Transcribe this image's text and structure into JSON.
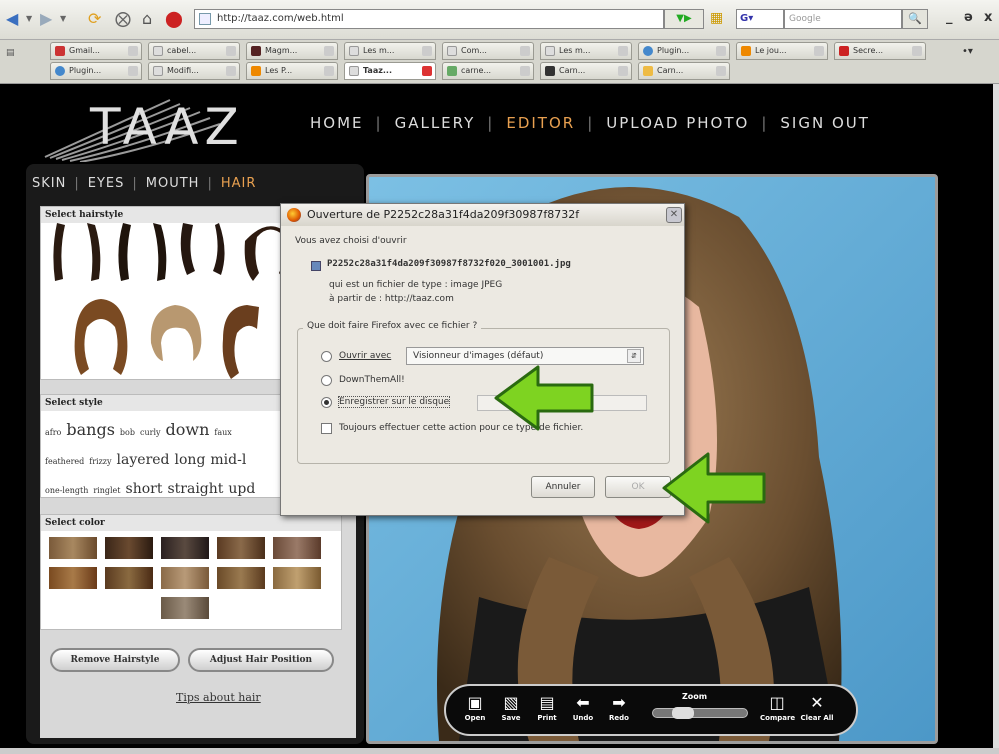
{
  "browser": {
    "url": "http://taaz.com/web.html",
    "search_engine": "G",
    "search_placeholder": "Google",
    "win_controls": [
      "_",
      "ə",
      "x"
    ]
  },
  "tabs_row1": [
    "Gmail...",
    "cabel...",
    "Magm...",
    "Les m...",
    "Com...",
    "Les m...",
    "Plugin...",
    "Le jou...",
    "Secre..."
  ],
  "tabs_row2": [
    "Plugin...",
    "Modifi...",
    "Les P...",
    "Taaz...",
    "carne...",
    "Carn...",
    "Carn..."
  ],
  "colors": {
    "accent_nav": "#e8a050",
    "photo_bg": "#5fa9d6",
    "arrow_green": "#7ed321"
  },
  "site": {
    "logo": "TAAZ",
    "nav": [
      "HOME",
      "GALLERY",
      "EDITOR",
      "UPLOAD PHOTO",
      "SIGN OUT"
    ],
    "active_nav": "EDITOR",
    "subtabs": [
      "SKIN",
      "EYES",
      "MOUTH",
      "HAIR"
    ],
    "active_subtab": "HAIR"
  },
  "hair_panel": {
    "select_hairstyle": "Select hairstyle",
    "select_style": "Select style",
    "style_tags": [
      [
        {
          "t": "afro",
          "s": "s"
        },
        {
          "t": "bangs",
          "s": "l"
        },
        {
          "t": "bob",
          "s": "s"
        },
        {
          "t": "curly",
          "s": "s"
        },
        {
          "t": "down",
          "s": "l"
        },
        {
          "t": "faux",
          "s": "s"
        }
      ],
      [
        {
          "t": "feathered",
          "s": "s"
        },
        {
          "t": "frizzy",
          "s": "s"
        },
        {
          "t": "layered",
          "s": "m"
        },
        {
          "t": "long",
          "s": "m"
        },
        {
          "t": "mid-l",
          "s": "m"
        }
      ],
      [
        {
          "t": "one-length",
          "s": "s"
        },
        {
          "t": "ringlet",
          "s": "s"
        },
        {
          "t": "short",
          "s": "m"
        },
        {
          "t": "straight",
          "s": "m"
        },
        {
          "t": "upd",
          "s": "m"
        }
      ]
    ],
    "select_color": "Select color",
    "remove_btn": "Remove Hairstyle",
    "adjust_btn": "Adjust Hair Position",
    "tips_link": "Tips about hair"
  },
  "editor_toolbar": {
    "open": "Open",
    "save": "Save",
    "print": "Print",
    "undo": "Undo",
    "redo": "Redo",
    "zoom": "Zoom",
    "zoom_level": 0.25,
    "compare": "Compare",
    "clear_all": "Clear All"
  },
  "dialog": {
    "title": "Ouverture de P2252c28a31f4da209f30987f8732f",
    "chose_open": "Vous avez choisi d'ouvrir",
    "filename": "P2252c28a31f4da209f30987f8732f020_3001001.jpg",
    "file_type": "qui est un fichier de type : image JPEG",
    "from": "à partir de : http://taaz.com",
    "question": "Que doit faire Firefox avec ce fichier ?",
    "open_with_label": "Ouvrir avec",
    "open_with_app": "Visionneur d'images (défaut)",
    "downthemall": "DownThemAll!",
    "save_to_disk": "Enregistrer sur le disque",
    "selected_option": "save_to_disk",
    "always_do": "Toujours effectuer cette action pour ce type de fichier.",
    "always_checked": false,
    "cancel": "Annuler",
    "ok": "OK"
  }
}
